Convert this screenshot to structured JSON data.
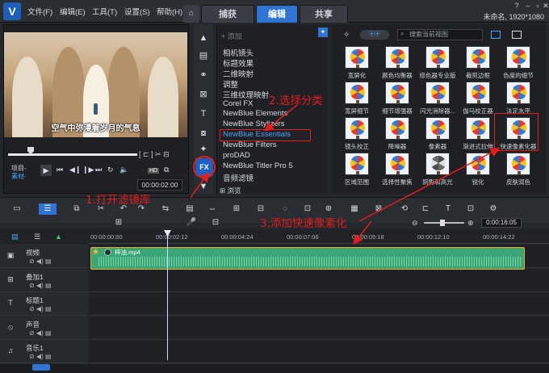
{
  "menu": {
    "items": [
      "文件(F)",
      "编辑(E)",
      "工具(T)",
      "设置(S)",
      "帮助(H)"
    ]
  },
  "tabs": [
    {
      "label": "捕获",
      "active": false
    },
    {
      "label": "编辑",
      "active": true
    },
    {
      "label": "共享",
      "active": false
    }
  ],
  "project": {
    "name": "未命名, 1920*1080"
  },
  "preview": {
    "subtitle": "空气中弥漫着岁月的气息",
    "timecode": "00:00:02:00",
    "mode_project": "项目-",
    "mode_clip": "素材-",
    "hd_badge": "HD"
  },
  "library": {
    "add_label": "添加",
    "browse_label": "浏览",
    "search_placeholder": "搜索当前视图",
    "categories": [
      "相机镜头",
      "标题效果",
      "二维映射",
      "调整",
      "三维纹理映射",
      "Corel FX",
      "NewBlue Elements",
      "NewBlue Stylizers",
      "NewBlue Essentials",
      "NewBlue Filters",
      "proDAD",
      "NewBlue Titler Pro 5",
      "音频滤镜"
    ],
    "selected_category": "NewBlue Essentials",
    "filters": [
      "宽屏化",
      "颜色均衡器",
      "修色器专业版",
      "裁剪边框",
      "色度的细节",
      "宽屏细节",
      "细节增强器",
      "闪光消除器...",
      "伽马校正器",
      "法定水平",
      "镜头校正",
      "降噪器",
      "像素器",
      "渐进式拉伸",
      "快速像素化器",
      "区域范围",
      "选择性聚焦",
      "阴影和高光",
      "锐化",
      "皮肤润色"
    ],
    "selected_filter": "快速像素化器"
  },
  "timeline": {
    "ruler": [
      "00:00:00:00",
      "00:00:02:12",
      "00:00:04:24",
      "00:00:07:06",
      "00:00:09:18",
      "00:00:12:10",
      "00:00:14:22"
    ],
    "timecode": "0:00:16:05",
    "tracks": [
      "视频",
      "叠加1",
      "标题1",
      "声音",
      "音乐1"
    ],
    "clip_name": "梓油.mp4"
  },
  "annotations": {
    "step1": "1.打开滤镜库",
    "step2": "2.选择分类",
    "step3": "3.添加快速像素化"
  },
  "colors": {
    "accent": "#2f73d3",
    "annotation": "#e31c1c",
    "clip": "#3aa577"
  }
}
